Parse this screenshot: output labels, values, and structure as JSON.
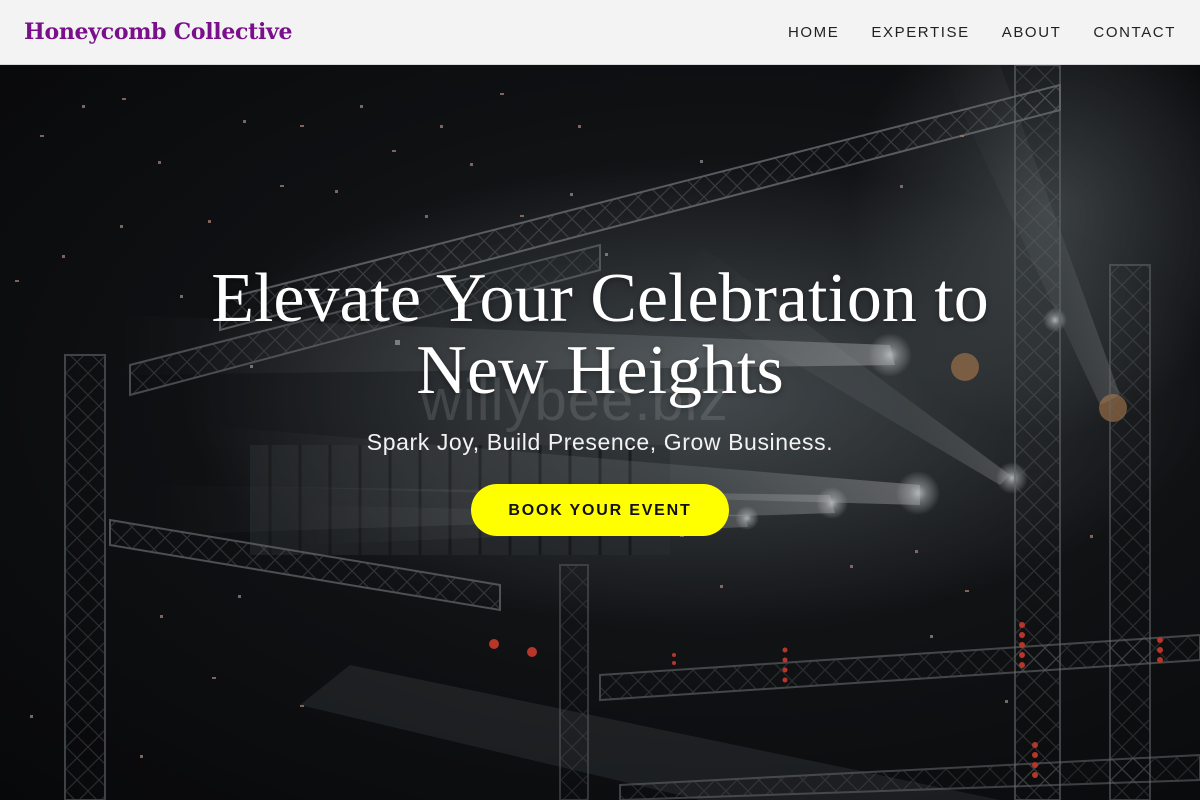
{
  "navbar": {
    "brand": "Honeycomb Collective",
    "links": [
      {
        "label": "HOME"
      },
      {
        "label": "EXPERTISE"
      },
      {
        "label": "ABOUT"
      },
      {
        "label": "CONTACT"
      }
    ]
  },
  "hero": {
    "title": "Elevate Your Celebration to New Heights",
    "subtitle": "Spark Joy, Build Presence, Grow Business.",
    "cta_label": "BOOK YOUR EVENT",
    "watermark": "willybee.biz"
  },
  "colors": {
    "brand": "#7a0f8c",
    "cta_background": "#ffff00",
    "navbar_background": "#f3f3f3"
  }
}
